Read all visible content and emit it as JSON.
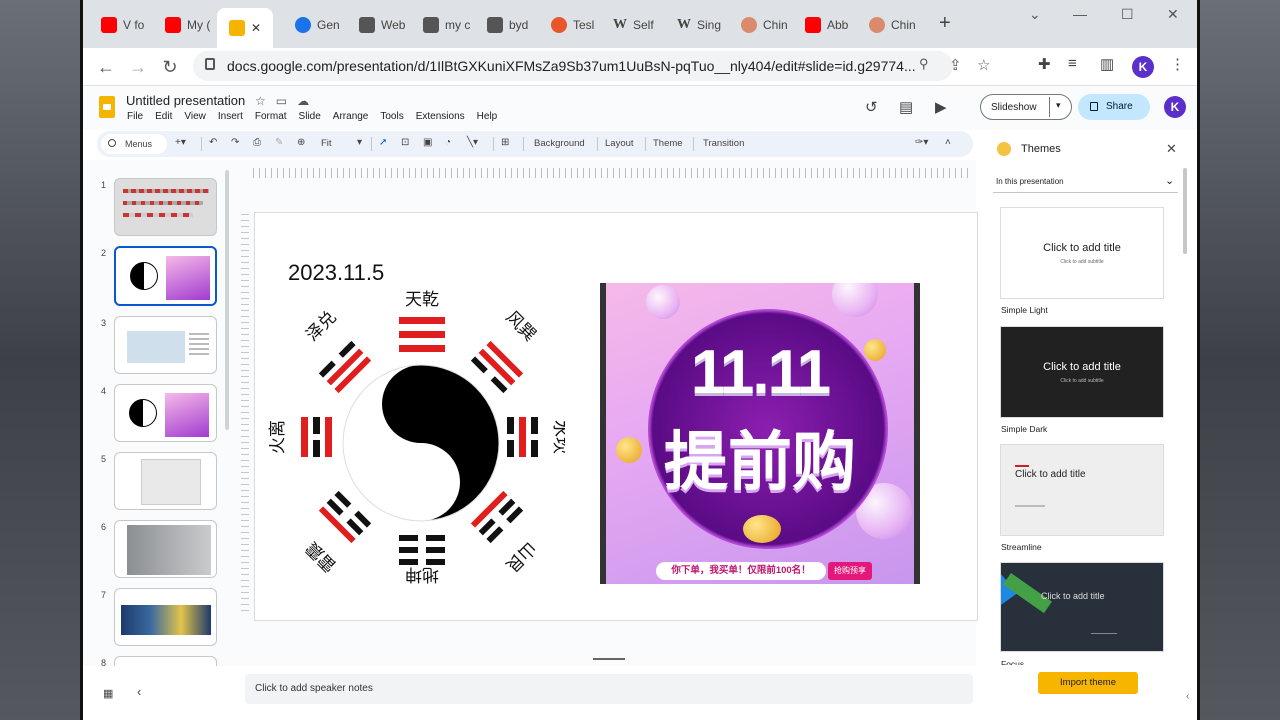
{
  "browser": {
    "tabs": [
      {
        "label": "V fo",
        "color": "#ff0000"
      },
      {
        "label": "My (",
        "color": "#ff0000"
      },
      {
        "label": "",
        "color": "#f4b400"
      },
      {
        "label": "Gen",
        "color": "#1a73e8"
      },
      {
        "label": "Web",
        "color": "#555555"
      },
      {
        "label": "my c",
        "color": "#555555"
      },
      {
        "label": "byd",
        "color": "#555555"
      },
      {
        "label": "Tesl",
        "color": "#e8572a"
      },
      {
        "label": "Self",
        "color": "#222222"
      },
      {
        "label": "Sing",
        "color": "#222222"
      },
      {
        "label": "Chin",
        "color": "#d98b6b"
      },
      {
        "label": "Abb",
        "color": "#ff0000"
      },
      {
        "label": "Chin",
        "color": "#d98b6b"
      }
    ],
    "active_tab_close": "✕",
    "new_tab": "+",
    "url": "docs.google.com/presentation/d/1IlBtGXKuniXFMsZa9Sb37um1UuBsN-pqTuo__nly404/edit#slide=id.g29774...",
    "profile_initial": "K"
  },
  "app": {
    "doc_title": "Untitled presentation",
    "menu": [
      "File",
      "Edit",
      "View",
      "Insert",
      "Format",
      "Slide",
      "Arrange",
      "Tools",
      "Extensions",
      "Help"
    ],
    "slideshow_label": "Slideshow",
    "share_label": "Share",
    "profile_initial": "K"
  },
  "toolbar": {
    "menus_label": "Menus",
    "zoom_label": "Fit",
    "background_label": "Background",
    "layout_label": "Layout",
    "theme_label": "Theme",
    "transition_label": "Transition"
  },
  "filmstrip": {
    "slide_numbers": [
      "1",
      "2",
      "3",
      "4",
      "5",
      "6",
      "7",
      "8"
    ],
    "selected_index": 2
  },
  "slide": {
    "date": "2023.11.5",
    "bagua_labels": {
      "top": "天乾",
      "top_right": "风巽",
      "right": "水坎",
      "bottom_right": "山艮",
      "bottom": "地坤",
      "bottom_left": "雷震",
      "left": "火离",
      "top_left": "泽兑"
    },
    "promo": {
      "line1": "11.11",
      "line2": "提前购",
      "strip": "你下单，我买单！仅限前100名！",
      "button": "抢购预享"
    }
  },
  "speaker_notes": "Click to add speaker notes",
  "themes_panel": {
    "title": "Themes",
    "section": "In this presentation",
    "cards": [
      {
        "name": "Simple Light",
        "title": "Click to add title",
        "subtitle": "Click to add subtitle"
      },
      {
        "name": "Simple Dark",
        "title": "Click to add title",
        "subtitle": "Click to add subtitle"
      },
      {
        "name": "Streamline",
        "title": "Click to add title",
        "subtitle": ""
      },
      {
        "name": "Focus",
        "title": "Click to add title",
        "subtitle": ""
      }
    ],
    "import_label": "Import theme"
  },
  "colors": {
    "accent": "#0b57d0",
    "share": "#c2e7ff",
    "import": "#f7b500",
    "trigram_red": "#e01e1e"
  }
}
